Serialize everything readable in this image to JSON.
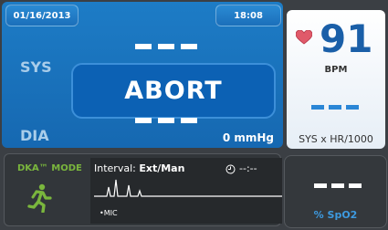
{
  "header": {
    "date": "01/16/2013",
    "time": "18:08"
  },
  "bp": {
    "sys_label": "SYS",
    "dia_label": "DIA",
    "status": "ABORT",
    "pressure": "0 mmHg"
  },
  "heart_rate": {
    "value": "91",
    "unit": "BPM",
    "sysxhr_label": "SYS x HR/1000"
  },
  "dka": {
    "mode_label": "DKA™ MODE",
    "interval_prefix": "Interval: ",
    "interval_value": "Ext/Man",
    "timer_value": "--:--",
    "mic_label": "•MIC"
  },
  "spo2": {
    "label": "% SpO2"
  },
  "colors": {
    "bp_blue": "#1668b1",
    "hr_value": "#1a5fa8",
    "dka_green": "#7ab63d",
    "spo2_label": "#3d9ae0"
  },
  "icons": [
    "heart-icon",
    "runner-icon",
    "timer-icon"
  ]
}
